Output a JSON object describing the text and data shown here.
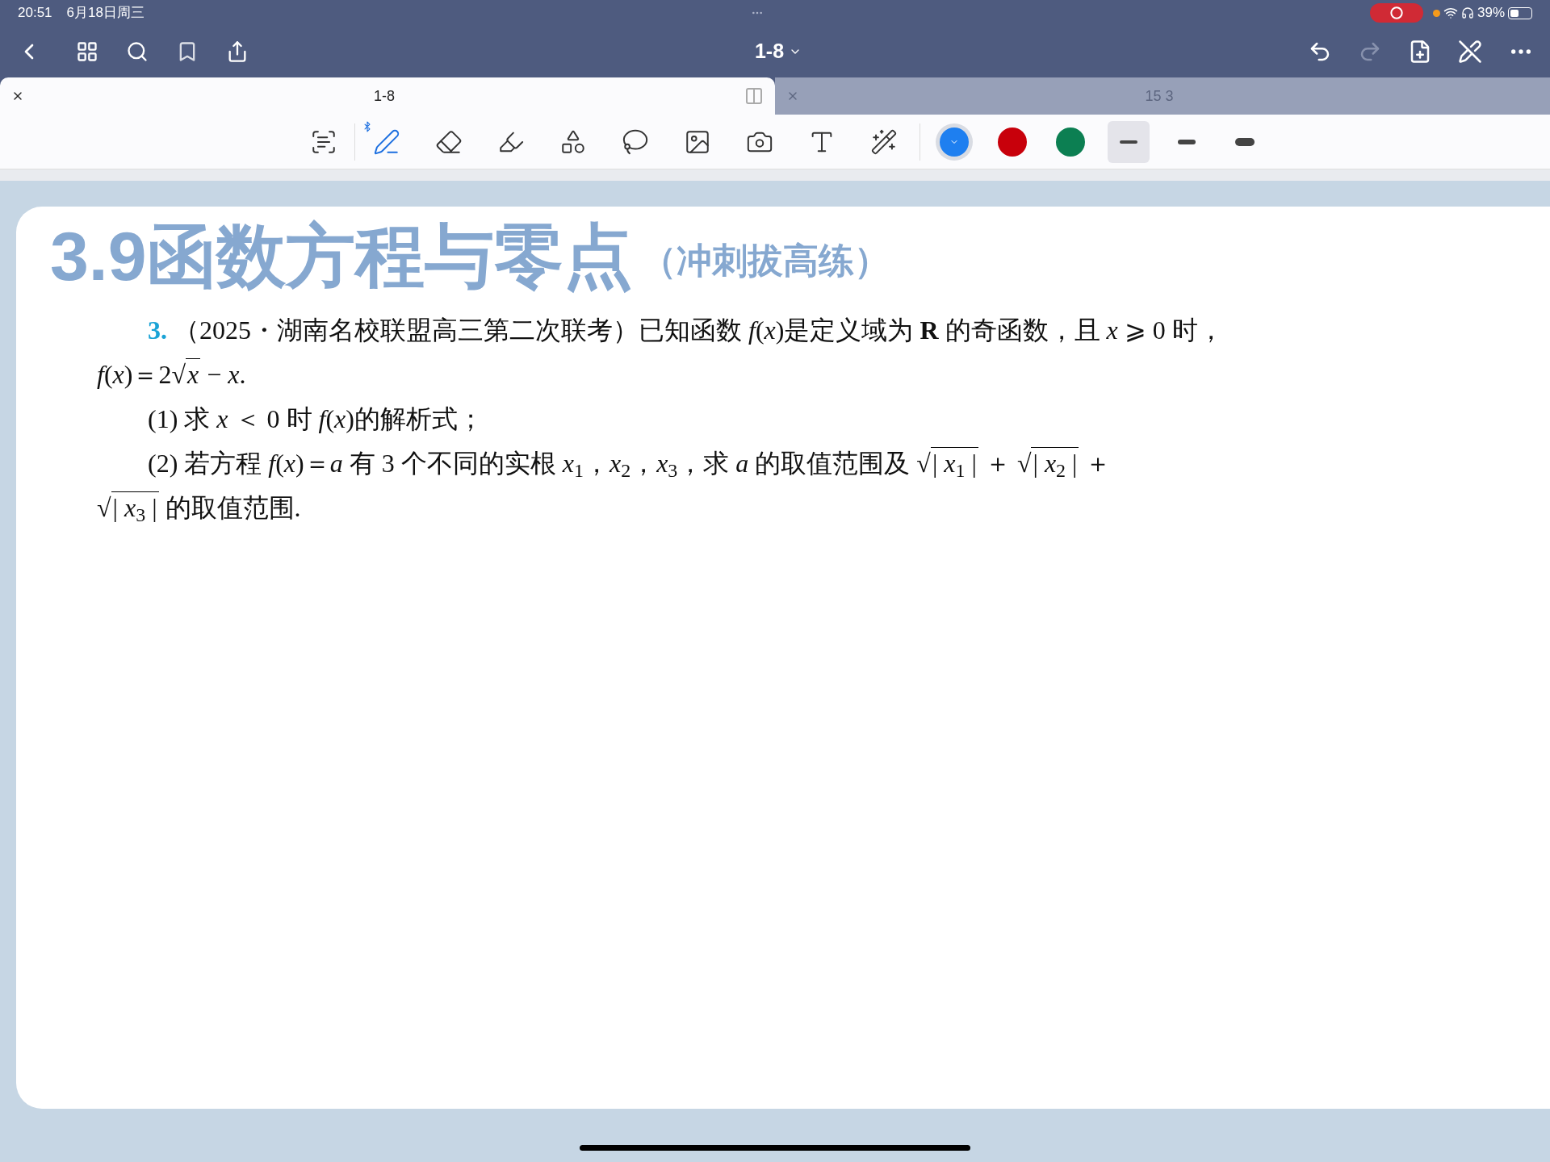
{
  "status_bar": {
    "time": "20:51",
    "date": "6月18日周三",
    "battery": "39%"
  },
  "nav": {
    "title": "1-8",
    "redo_disabled": true
  },
  "tabs": [
    {
      "label": "1-8",
      "selected": true
    },
    {
      "label": "15 3",
      "selected": false
    }
  ],
  "tools": [
    {
      "kind": "readonly",
      "selected": false
    },
    {
      "kind": "pen",
      "selected": true
    },
    {
      "kind": "eraser",
      "selected": false
    },
    {
      "kind": "highlighter",
      "selected": false
    },
    {
      "kind": "shapes",
      "selected": false
    },
    {
      "kind": "lasso",
      "selected": false
    },
    {
      "kind": "image",
      "selected": false
    },
    {
      "kind": "camera",
      "selected": false
    },
    {
      "kind": "text",
      "selected": false
    },
    {
      "kind": "laser",
      "selected": false
    }
  ],
  "colors": [
    {
      "color": "#1e7ff0",
      "selected": true
    },
    {
      "color": "#c8000b",
      "selected": false
    },
    {
      "color": "#0c7f52",
      "selected": false
    }
  ],
  "strokes": [
    {
      "kind": "thin",
      "selected": true
    },
    {
      "kind": "medium",
      "selected": false
    },
    {
      "kind": "thick",
      "selected": false
    }
  ],
  "page": {
    "title": "3.9函数方程与零点",
    "subtitle": "（冲刺拔高练）",
    "question_number": "3.",
    "paragraphs": [
      {
        "lines": [
          [
            {
              "kind": "text",
              "text": "（2025・湖南名校联盟高三第二次联考）已知函数 *f*(*x*)是定义域为 **R** 的奇函数，且 *x* ⩾ 0 时，"
            }
          ],
          [
            {
              "kind": "text",
              "text": "*f*(*x*)＝2"
            },
            {
              "kind": "text",
              "text": "√"
            },
            {
              "kind": "overline",
              "text": "*x*"
            },
            {
              "kind": "text",
              "text": " − *x*."
            }
          ]
        ]
      },
      {
        "lines": [
          [
            {
              "kind": "text",
              "text": "(1) 求 *x* ＜ 0 时 *f*(*x*)的解析式；"
            }
          ]
        ]
      },
      {
        "lines": [
          [
            {
              "kind": "text",
              "text": "(2) 若方程 *f*(*x*)＝*a* 有 3 个不同的实根 *x*$_{1}$，*x*$_{2}$，*x*$_{3}$，求 *a* 的取值范围及 "
            },
            {
              "kind": "text",
              "text": "√"
            },
            {
              "kind": "overline",
              "text": "| *x*$_{1}$ |"
            },
            {
              "kind": "text",
              "text": " ＋ "
            },
            {
              "kind": "text",
              "text": "√"
            },
            {
              "kind": "overline",
              "text": "| *x*$_{2}$ |"
            },
            {
              "kind": "text",
              "text": " ＋"
            }
          ],
          [
            {
              "kind": "text",
              "text": "√"
            },
            {
              "kind": "overline",
              "text": "| *x*$_{3}$ |"
            },
            {
              "kind": "text",
              "text": " 的取值范围."
            }
          ]
        ]
      }
    ]
  }
}
